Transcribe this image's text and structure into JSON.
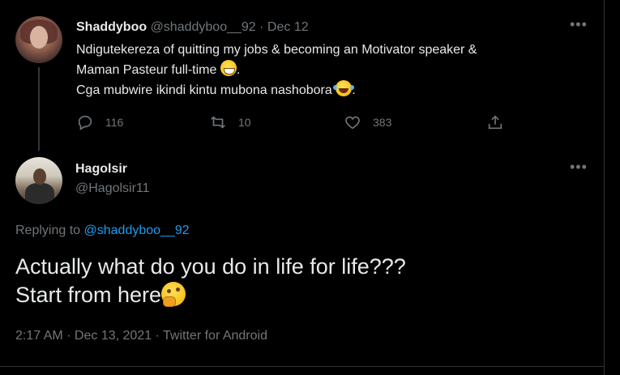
{
  "tweet1": {
    "display_name": "Shaddyboo",
    "handle": "@shaddyboo__92",
    "separator": "·",
    "date": "Dec 12",
    "line1": "Ndigutekereza of quitting my jobs & becoming an Motivator  speaker &",
    "line2": "Maman Pasteur  full-time",
    "line2_end": ".",
    "line3": "Cga mubwire ikindi kintu mubona nashobora",
    "line3_end": ".",
    "emoji_1": "grinning-face-with-smiling-eyes",
    "emoji_2": "face-with-tears-of-joy",
    "reply_count": "116",
    "retweet_count": "10",
    "like_count": "383",
    "more_label": "•••"
  },
  "tweet2": {
    "display_name": "Hagolsir",
    "handle": "@Hagolsir11",
    "more_label": "•••",
    "replying_prefix": "Replying to",
    "replying_to": "@shaddyboo__92",
    "text_line1": "Actually what do you do in life for life???",
    "text_line2": "Start from here",
    "emoji": "thinking-face",
    "timestamp": "2:17 AM · Dec 13, 2021 · Twitter for Android"
  },
  "colors": {
    "background": "#000000",
    "text": "#e7e9ea",
    "muted": "#71767b",
    "link": "#1d9bf0"
  }
}
